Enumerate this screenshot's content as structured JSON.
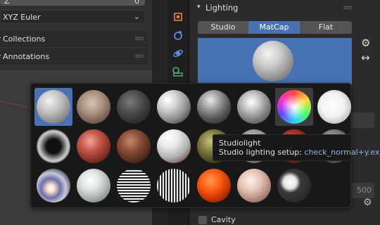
{
  "left": {
    "top_row": {
      "label": "Z",
      "value": "0"
    },
    "rotation_mode": "XYZ Euler",
    "subpanels": [
      {
        "label": "Collections"
      },
      {
        "label": "Annotations"
      }
    ]
  },
  "icons": {
    "tabs": [
      "object-icon",
      "modifier-icon",
      "physics-icon",
      "object-data-icon"
    ],
    "gear": "gear-icon",
    "swap": "swap-arrows-icon"
  },
  "lighting": {
    "title": "Lighting",
    "modes": [
      {
        "label": "Studio",
        "active": false
      },
      {
        "label": "MatCap",
        "active": true
      },
      {
        "label": "Flat",
        "active": false
      }
    ],
    "background_value": "500",
    "cavity_label": "Cavity"
  },
  "matcaps": {
    "rows": 3,
    "cols": 8,
    "selected_index": 0,
    "hovered_index": 6
  },
  "tooltip": {
    "title": "Studiolight",
    "label": "Studio lighting setup:",
    "value": "check_normal+y.exr"
  },
  "colors": {
    "accent": "#4772b3",
    "panel": "#2b2b2b",
    "tooltip_value": "#8cb4e8"
  }
}
